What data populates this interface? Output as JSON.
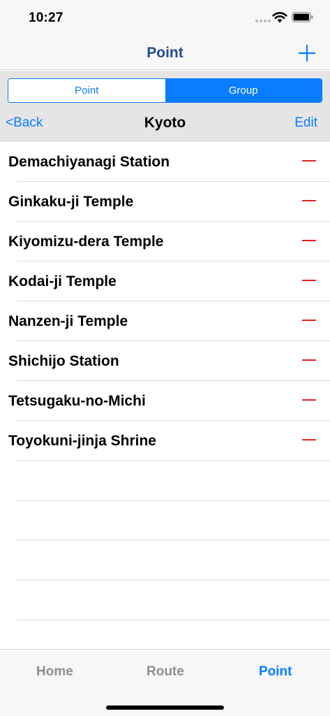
{
  "status_bar": {
    "time": "10:27"
  },
  "nav": {
    "title": "Point",
    "add_icon": "plus-icon"
  },
  "segmented": {
    "options": [
      "Point",
      "Group"
    ],
    "selected": "Group"
  },
  "group_header": {
    "back_label": "<Back",
    "title": "Kyoto",
    "edit_label": "Edit"
  },
  "points": [
    {
      "name": "Demachiyanagi Station"
    },
    {
      "name": "Ginkaku-ji Temple"
    },
    {
      "name": "Kiyomizu-dera Temple"
    },
    {
      "name": "Kodai-ji Temple"
    },
    {
      "name": "Nanzen-ji Temple"
    },
    {
      "name": "Shichijo Station"
    },
    {
      "name": "Tetsugaku-no-Michi"
    },
    {
      "name": "Toyokuni-jinja Shrine"
    }
  ],
  "tabs": [
    {
      "label": "Home",
      "active": false
    },
    {
      "label": "Route",
      "active": false
    },
    {
      "label": "Point",
      "active": true
    }
  ],
  "colors": {
    "accent": "#0a7cff",
    "nav_title": "#1f4e8c",
    "delete": "#e8201c",
    "inactive_tab": "#8e8e93"
  }
}
